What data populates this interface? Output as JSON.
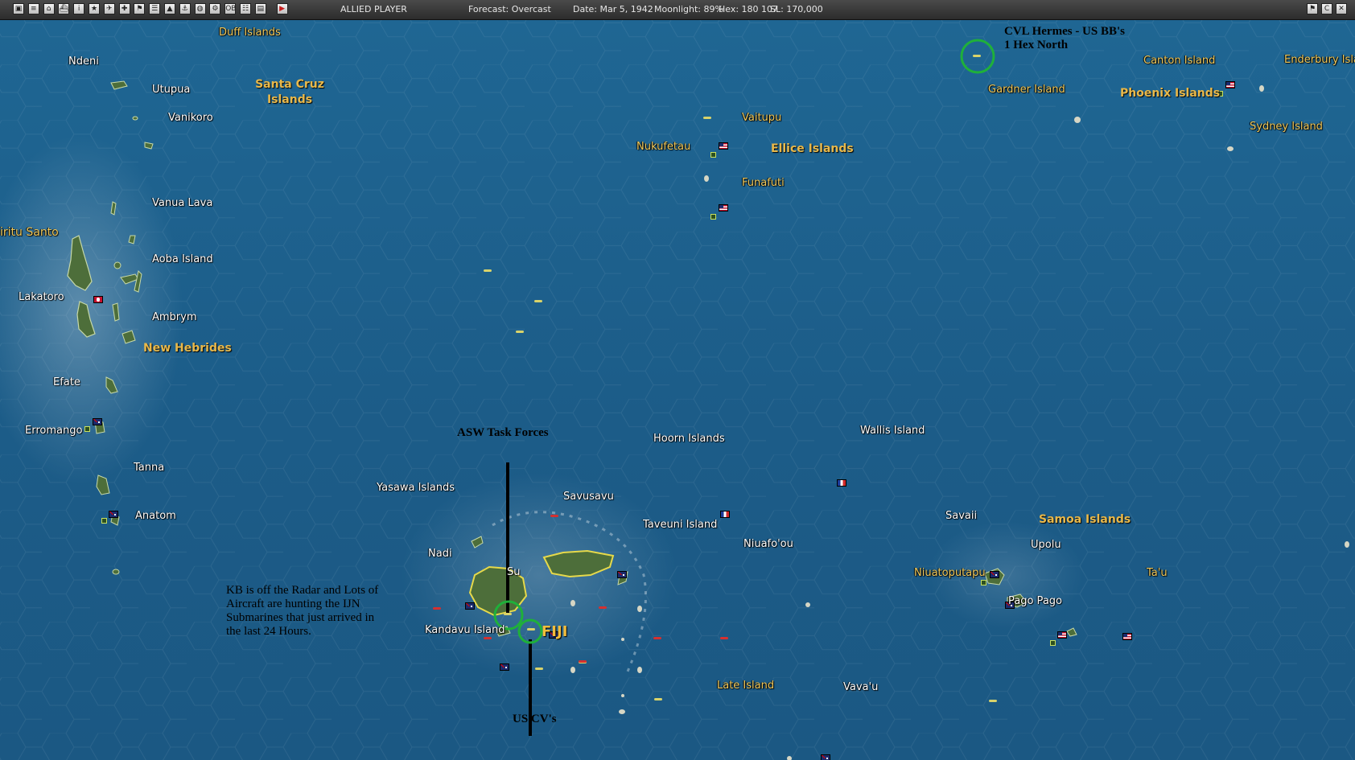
{
  "toolbar": {
    "side": "ALLIED PLAYER",
    "forecast": "Forecast: Overcast",
    "date": "Date: Mar 5, 1942",
    "moonlight": "Moonlight: 89%",
    "hex": "Hex: 180 107",
    "sl": "SL: 170,000",
    "buttons": [
      "report-icon",
      "list-icon",
      "base-icon",
      "ship-icon",
      "info-icon",
      "star-icon",
      "air-icon",
      "plane-icon",
      "flag-icon",
      "group-icon",
      "land-icon",
      "harbor-icon",
      "globe-icon",
      "settings-icon",
      "ob-icon",
      "menu-icon",
      "save-icon",
      "end-turn-icon"
    ],
    "right_buttons": [
      "flag-icon",
      "c-icon",
      "close-icon"
    ]
  },
  "map": {
    "places": {
      "duff": "Duff Islands",
      "ndeni": "Ndeni",
      "utupua": "Utupua",
      "vanikoro": "Vanikoro",
      "vanua_lava": "Vanua Lava",
      "espiritu_santo": "iritu Santo",
      "aoba": "Aoba Island",
      "lakatoro": "Lakatoro",
      "ambrym": "Ambrym",
      "efate": "Efate",
      "erromango": "Erromango",
      "tanna": "Tanna",
      "anatom": "Anatom",
      "vaitupu": "Vaitupu",
      "nukufetau": "Nukufetau",
      "funafuti": "Funafuti",
      "canton": "Canton Island",
      "enderbury": "Enderbury Isla",
      "gardner": "Gardner Island",
      "sydney": "Sydney Island",
      "hoorn": "Hoorn Islands",
      "wallis": "Wallis Island",
      "yasawa": "Yasawa Islands",
      "savusavu": "Savusavu",
      "taveuni": "Taveuni Island",
      "nadi": "Nadi",
      "suva": "Su",
      "kandavu": "Kandavu Island",
      "niuafoou": "Niuafo'ou",
      "savaii": "Savaii",
      "upolu": "Upolu",
      "niuatoputapu": "Niuatoputapu",
      "tau": "Ta'u",
      "pago_pago": "Pago Pago",
      "late": "Late Island",
      "vavau": "Vava'u"
    },
    "groups": {
      "santa_cruz": "Santa Cruz\nIslands",
      "new_hebrides": "New Hebrides",
      "ellice": "Ellice Islands",
      "phoenix": "Phoenix Islands",
      "samoa": "Samoa Islands",
      "fiji": "FIJI"
    },
    "annotations": {
      "hermes": "CVL Hermes - US BB's\n1 Hex North",
      "asw": "ASW Task Forces",
      "us_cv": "US CV's",
      "kb": "KB is off the Radar and Lots of\nAircraft are hunting the IJN\nSubmarines that just arrived in\nthe last 24 Hours."
    },
    "colors": {
      "sea": "#1d5f8e",
      "highlight_circle": "#1fb03a",
      "group_label": "#e8b84a",
      "yellow_label": "#f0c85a"
    }
  }
}
